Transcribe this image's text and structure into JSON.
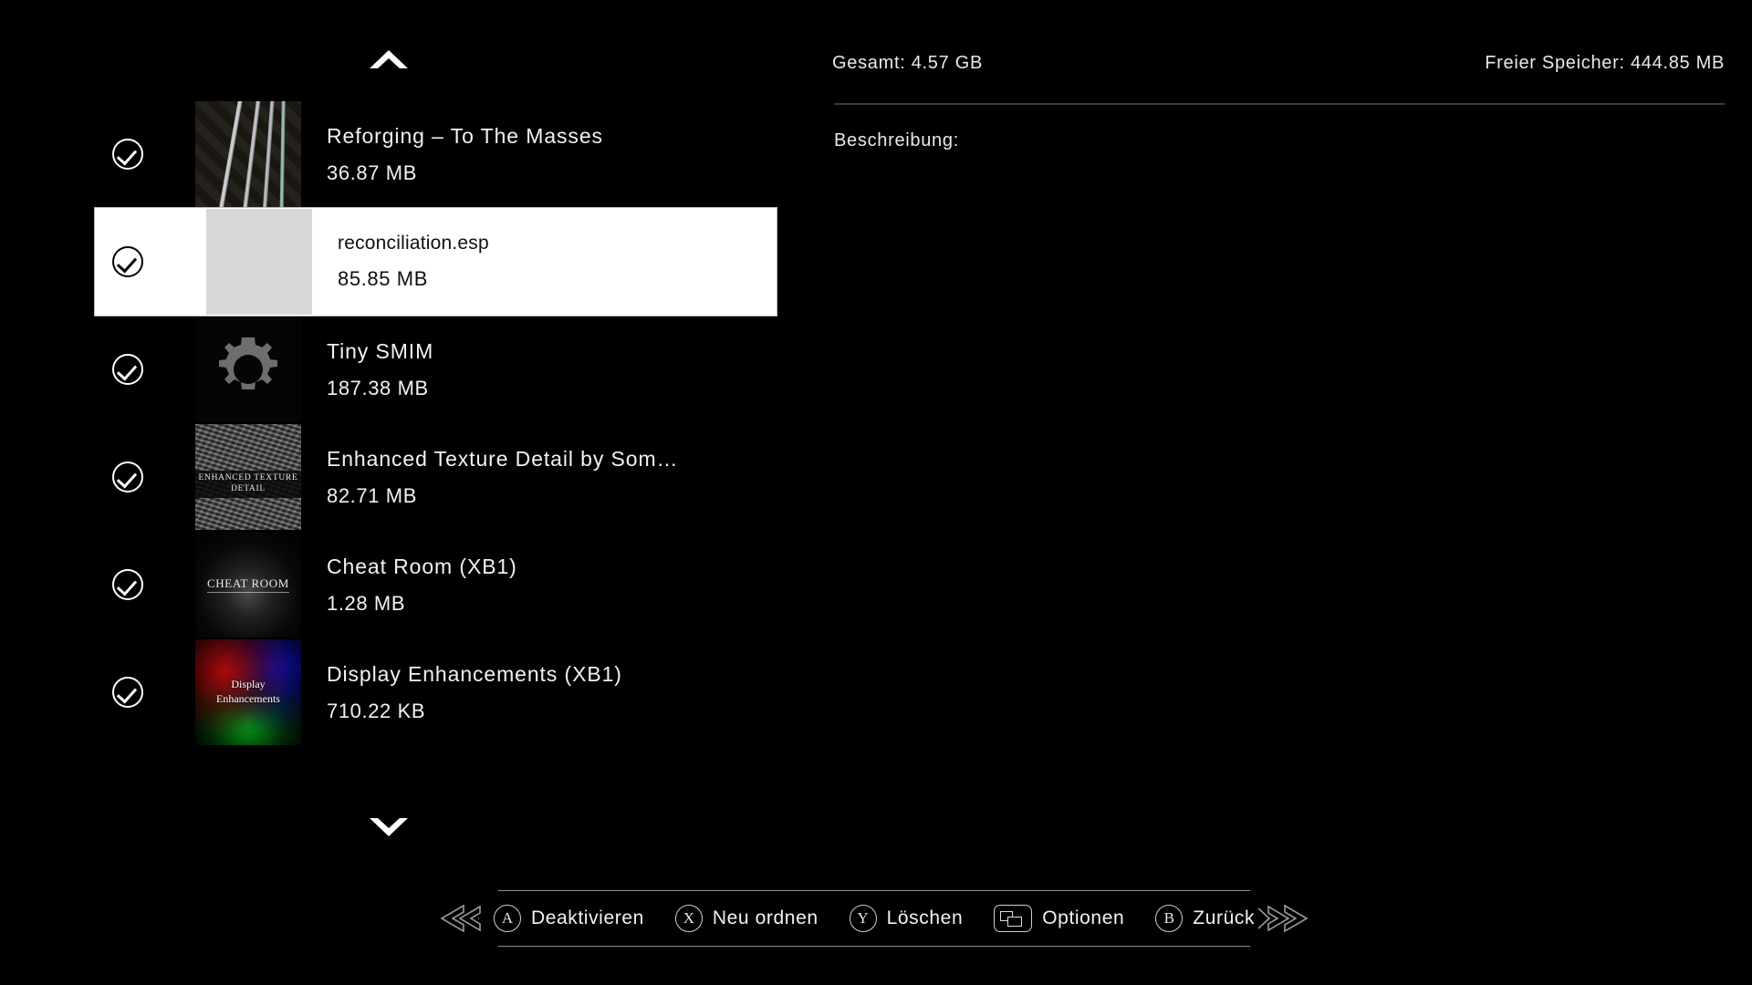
{
  "list": {
    "scroll_up_icon": "chevron-up-icon",
    "scroll_down_icon": "chevron-down-icon",
    "items": [
      {
        "title": "Reforging – To The Masses",
        "size": "36.87 MB",
        "enabled_icon": "check-circle-icon",
        "thumb": "swords",
        "selected": false
      },
      {
        "title": "reconciliation.esp",
        "size": "85.85 MB",
        "enabled_icon": "check-circle-icon",
        "thumb": "blank",
        "selected": true
      },
      {
        "title": "Tiny SMIM",
        "size": "187.38 MB",
        "enabled_icon": "check-circle-icon",
        "thumb": "gear",
        "selected": false
      },
      {
        "title": "Enhanced Texture Detail by Som…",
        "size": "82.71 MB",
        "enabled_icon": "check-circle-icon",
        "thumb": "texture",
        "thumb_text_line1": "ENHANCED TEXTURE",
        "thumb_text_line2": "DETAIL",
        "selected": false
      },
      {
        "title": "Cheat Room (XB1)",
        "size": "1.28 MB",
        "enabled_icon": "check-circle-icon",
        "thumb": "cheat",
        "thumb_text": "CHEAT ROOM",
        "selected": false
      },
      {
        "title": "Display Enhancements (XB1)",
        "size": "710.22 KB",
        "enabled_icon": "check-circle-icon",
        "thumb": "display",
        "thumb_text_line1": "Display",
        "thumb_text_line2": "Enhancements",
        "selected": false
      }
    ]
  },
  "info": {
    "total_storage": "Gesamt: 4.57 GB",
    "free_storage": "Freier Speicher: 444.85 MB",
    "description_label": "Beschreibung:",
    "description_body": ""
  },
  "button_bar": {
    "items": [
      {
        "glyph": "A",
        "glyph_type": "round",
        "icon_name": "button-a-icon",
        "label": "Deaktivieren"
      },
      {
        "glyph": "X",
        "glyph_type": "round",
        "icon_name": "button-x-icon",
        "label": "Neu ordnen"
      },
      {
        "glyph": "Y",
        "glyph_type": "round",
        "icon_name": "button-y-icon",
        "label": "Löschen"
      },
      {
        "glyph": "",
        "glyph_type": "view",
        "icon_name": "view-button-icon",
        "label": "Optionen"
      },
      {
        "glyph": "B",
        "glyph_type": "round",
        "icon_name": "button-b-icon",
        "label": "Zurück"
      }
    ]
  },
  "colors": {
    "background": "#000000",
    "text": "#f2f2f2",
    "selected_bg": "#ffffff",
    "selected_text": "#101010",
    "divider": "#3a3a3a",
    "bar_border": "#8e8e8e"
  }
}
